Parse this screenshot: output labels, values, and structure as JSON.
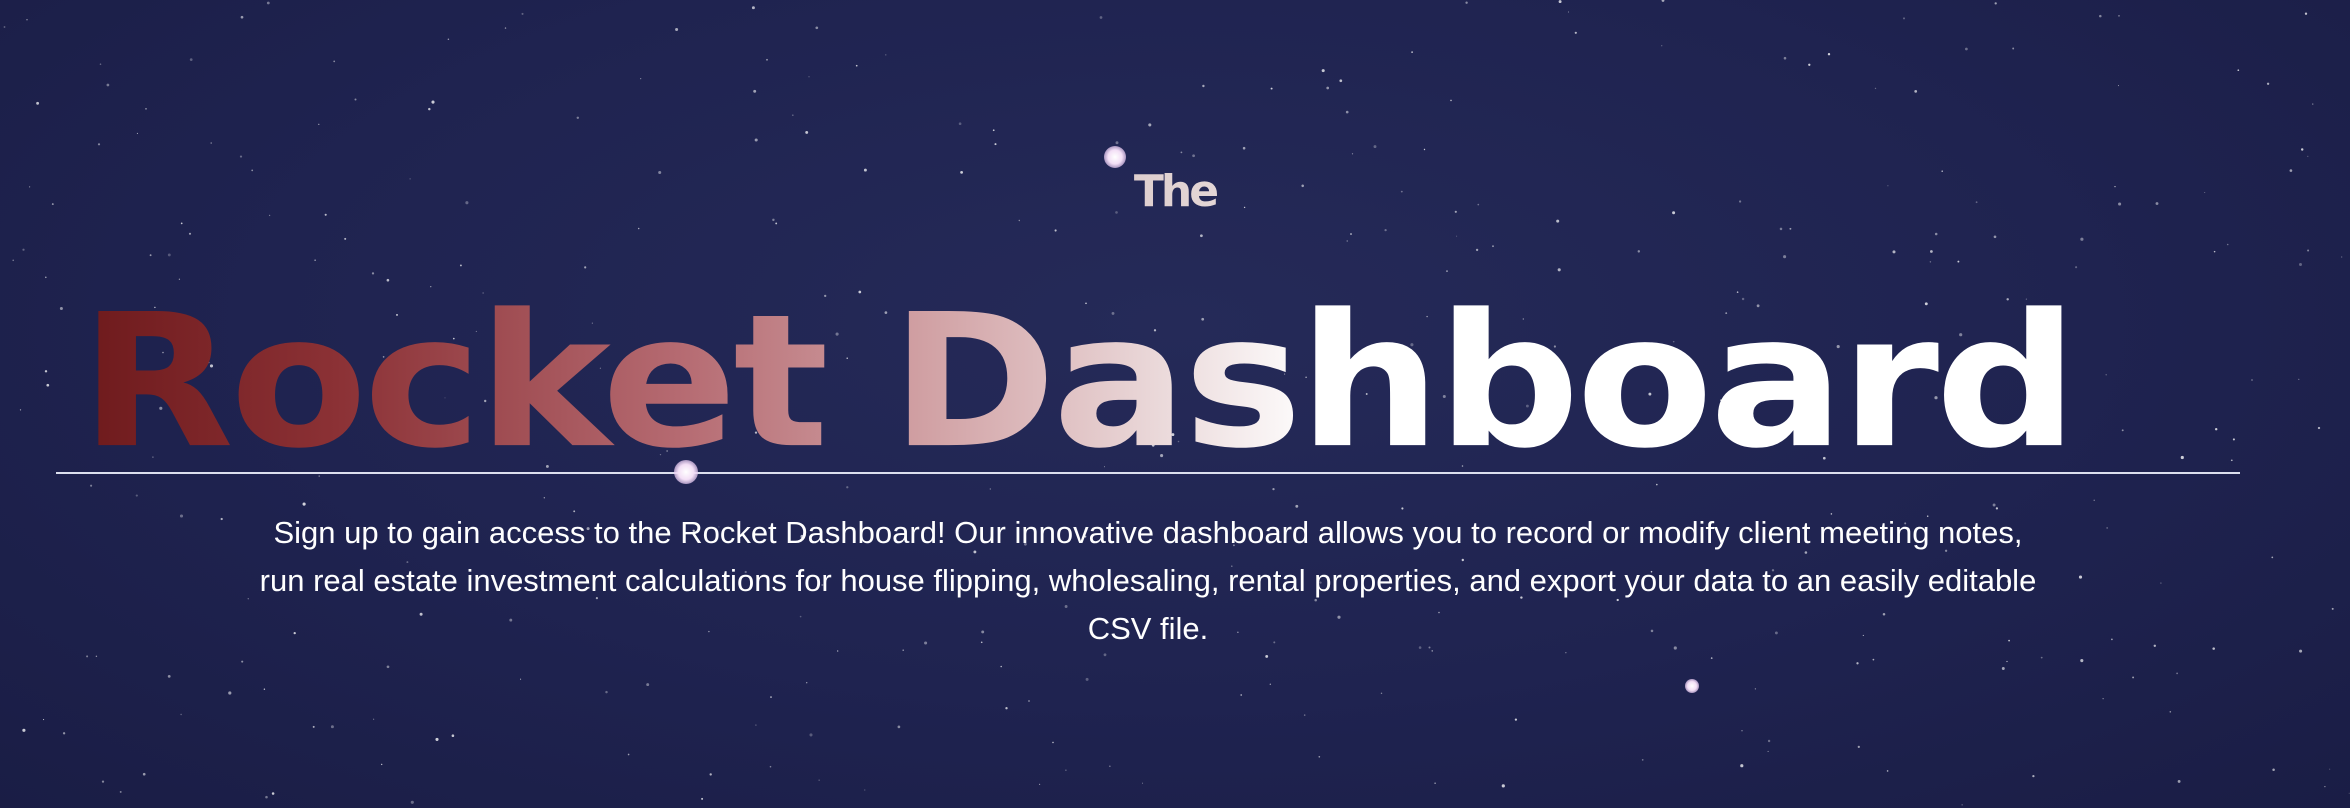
{
  "hero": {
    "pre_title": "The",
    "title": "Rocket Dashboard",
    "description": "Sign up to gain access to the Rocket Dashboard! Our innovative dashboard allows you to record or modify client meeting notes, run real estate investment calculations for house flipping, wholesaling, rental properties, and export your data to an easily editable CSV file."
  },
  "colors": {
    "background": "#1f2350",
    "title_gradient_start": "#6e1a1c",
    "title_gradient_end": "#ffffff",
    "text": "#ffffff"
  }
}
